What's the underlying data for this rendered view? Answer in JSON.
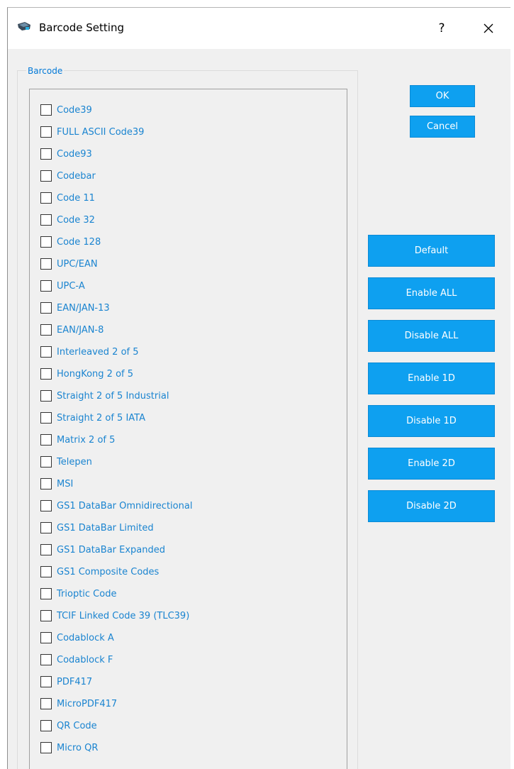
{
  "window": {
    "title": "Barcode Setting",
    "help_label": "?"
  },
  "group": {
    "label": "Barcode"
  },
  "barcodes": [
    "Code39",
    "FULL ASCII Code39",
    "Code93",
    "Codebar",
    "Code 11",
    "Code 32",
    "Code 128",
    "UPC/EAN",
    "UPC-A",
    "EAN/JAN-13",
    "EAN/JAN-8",
    "Interleaved 2 of 5",
    "HongKong 2 of 5",
    "Straight 2 of 5 Industrial",
    "Straight 2 of 5 IATA",
    "Matrix 2 of 5",
    "Telepen",
    "MSI",
    "GS1 DataBar Omnidirectional",
    "GS1 DataBar Limited",
    "GS1 DataBar Expanded",
    "GS1 Composite Codes",
    "Trioptic Code",
    "TCIF Linked Code 39 (TLC39)",
    "Codablock A",
    "Codablock F",
    "PDF417",
    "MicroPDF417",
    "QR Code",
    "Micro QR"
  ],
  "buttons": {
    "ok": "OK",
    "cancel": "Cancel",
    "default": "Default",
    "enable_all": "Enable ALL",
    "disable_all": "Disable ALL",
    "enable_1d": "Enable 1D",
    "disable_1d": "Disable 1D",
    "enable_2d": "Enable 2D",
    "disable_2d": "Disable 2D"
  },
  "colors": {
    "accent_button": "#0ea0f0",
    "label_text": "#1a84d0",
    "dialog_background": "#f0f0f0"
  }
}
